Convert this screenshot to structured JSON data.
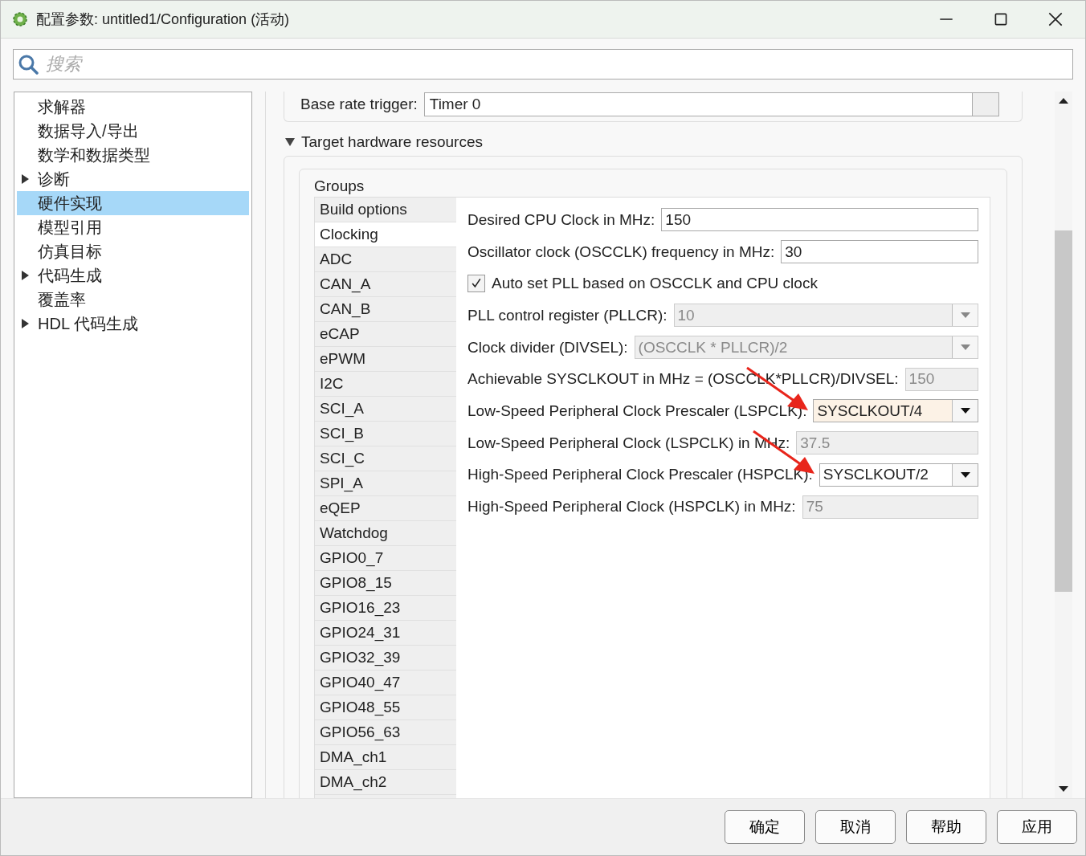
{
  "window": {
    "title": "配置参数: untitled1/Configuration (活动)"
  },
  "search": {
    "placeholder": "搜索"
  },
  "tree": [
    {
      "label": "求解器",
      "kind": "leaf",
      "selected": false
    },
    {
      "label": "数据导入/导出",
      "kind": "leaf",
      "selected": false
    },
    {
      "label": "数学和数据类型",
      "kind": "leaf",
      "selected": false
    },
    {
      "label": "诊断",
      "kind": "branch",
      "selected": false
    },
    {
      "label": "硬件实现",
      "kind": "leaf",
      "selected": true
    },
    {
      "label": "模型引用",
      "kind": "leaf",
      "selected": false
    },
    {
      "label": "仿真目标",
      "kind": "leaf",
      "selected": false
    },
    {
      "label": "代码生成",
      "kind": "branch",
      "selected": false
    },
    {
      "label": "覆盖率",
      "kind": "leaf",
      "selected": false
    },
    {
      "label": "HDL 代码生成",
      "kind": "branch",
      "selected": false
    }
  ],
  "base_rate": {
    "label": "Base rate trigger:",
    "value": "Timer 0"
  },
  "section": {
    "title": "Target hardware resources",
    "expanded": true
  },
  "groups": {
    "title": "Groups",
    "items": [
      {
        "label": "Build options",
        "selected": false
      },
      {
        "label": "Clocking",
        "selected": true
      },
      {
        "label": "ADC",
        "selected": false
      },
      {
        "label": "CAN_A",
        "selected": false
      },
      {
        "label": "CAN_B",
        "selected": false
      },
      {
        "label": "eCAP",
        "selected": false
      },
      {
        "label": "ePWM",
        "selected": false
      },
      {
        "label": "I2C",
        "selected": false
      },
      {
        "label": "SCI_A",
        "selected": false
      },
      {
        "label": "SCI_B",
        "selected": false
      },
      {
        "label": "SCI_C",
        "selected": false
      },
      {
        "label": "SPI_A",
        "selected": false
      },
      {
        "label": "eQEP",
        "selected": false
      },
      {
        "label": "Watchdog",
        "selected": false
      },
      {
        "label": "GPIO0_7",
        "selected": false
      },
      {
        "label": "GPIO8_15",
        "selected": false
      },
      {
        "label": "GPIO16_23",
        "selected": false
      },
      {
        "label": "GPIO24_31",
        "selected": false
      },
      {
        "label": "GPIO32_39",
        "selected": false
      },
      {
        "label": "GPIO40_47",
        "selected": false
      },
      {
        "label": "GPIO48_55",
        "selected": false
      },
      {
        "label": "GPIO56_63",
        "selected": false
      },
      {
        "label": "DMA_ch1",
        "selected": false
      },
      {
        "label": "DMA_ch2",
        "selected": false
      }
    ]
  },
  "params": [
    {
      "kind": "field",
      "label": "Desired CPU Clock in MHz:",
      "value": "150",
      "disabled": false,
      "modified": false,
      "marked": false
    },
    {
      "kind": "field",
      "label": "Oscillator clock (OSCCLK) frequency in MHz:",
      "value": "30",
      "disabled": false,
      "modified": false,
      "marked": false
    },
    {
      "kind": "checkbox",
      "label": "Auto set PLL based on OSCCLK and CPU clock",
      "checked": true
    },
    {
      "kind": "dropdown",
      "label": "PLL control register (PLLCR):",
      "value": "10",
      "disabled": true,
      "modified": false,
      "marked": false
    },
    {
      "kind": "dropdown",
      "label": "Clock divider (DIVSEL):",
      "value": "(OSCCLK * PLLCR)/2",
      "disabled": true,
      "modified": false,
      "marked": false
    },
    {
      "kind": "field",
      "label": "Achievable SYSCLKOUT in MHz = (OSCCLK*PLLCR)/DIVSEL:",
      "value": "150",
      "disabled": true,
      "modified": false,
      "marked": false
    },
    {
      "kind": "dropdown",
      "label": "Low-Speed Peripheral Clock Prescaler (LSPCLK):",
      "value": "SYSCLKOUT/4",
      "disabled": false,
      "modified": true,
      "marked": true
    },
    {
      "kind": "field",
      "label": "Low-Speed Peripheral Clock (LSPCLK) in MHz:",
      "value": "37.5",
      "disabled": true,
      "modified": false,
      "marked": false
    },
    {
      "kind": "dropdown",
      "label": "High-Speed Peripheral Clock Prescaler (HSPCLK):",
      "value": "SYSCLKOUT/2",
      "disabled": false,
      "modified": false,
      "marked": true
    },
    {
      "kind": "field",
      "label": "High-Speed Peripheral Clock (HSPCLK) in MHz:",
      "value": "75",
      "disabled": true,
      "modified": false,
      "marked": false
    }
  ],
  "buttons": [
    "确定",
    "取消",
    "帮助",
    "应用"
  ]
}
